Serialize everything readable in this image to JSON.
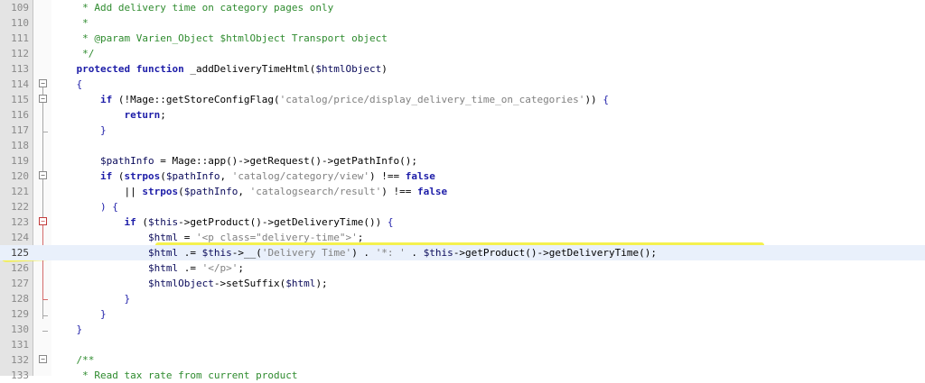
{
  "editor": {
    "lines": [
      {
        "n": "109",
        "s": [
          {
            "t": "     "
          },
          {
            "c": "t-cm",
            "t": "* Add delivery time on category pages only"
          }
        ]
      },
      {
        "n": "110",
        "s": [
          {
            "t": "     "
          },
          {
            "c": "t-cm",
            "t": "*"
          }
        ]
      },
      {
        "n": "111",
        "s": [
          {
            "t": "     "
          },
          {
            "c": "t-cm",
            "t": "* @param Varien_Object $htmlObject Transport object"
          }
        ]
      },
      {
        "n": "112",
        "s": [
          {
            "t": "     "
          },
          {
            "c": "t-cm",
            "t": "*/"
          }
        ]
      },
      {
        "n": "113",
        "s": [
          {
            "t": "    "
          },
          {
            "c": "t-kw",
            "t": "protected function"
          },
          {
            "c": "t-fn",
            "t": " _addDeliveryTimeHtml("
          },
          {
            "c": "t-var",
            "t": "$htmlObject"
          },
          {
            "c": "t-fn",
            "t": ")"
          }
        ]
      },
      {
        "n": "114",
        "s": [
          {
            "t": "    "
          },
          {
            "c": "t-br",
            "t": "{"
          }
        ]
      },
      {
        "n": "115",
        "s": [
          {
            "t": "        "
          },
          {
            "c": "t-kw",
            "t": "if"
          },
          {
            "c": "t-op",
            "t": " (!Mage::getStoreConfigFlag("
          },
          {
            "c": "t-str",
            "t": "'catalog/price/display_delivery_time_on_categories'"
          },
          {
            "c": "t-op",
            "t": ")) "
          },
          {
            "c": "t-br",
            "t": "{"
          }
        ]
      },
      {
        "n": "116",
        "s": [
          {
            "t": "            "
          },
          {
            "c": "t-kw",
            "t": "return"
          },
          {
            "c": "t-op",
            "t": ";"
          }
        ]
      },
      {
        "n": "117",
        "s": [
          {
            "t": "        "
          },
          {
            "c": "t-br",
            "t": "}"
          }
        ]
      },
      {
        "n": "118",
        "s": []
      },
      {
        "n": "119",
        "s": [
          {
            "t": "        "
          },
          {
            "c": "t-var",
            "t": "$pathInfo"
          },
          {
            "c": "t-op",
            "t": " = Mage::app()->getRequest()->getPathInfo();"
          }
        ]
      },
      {
        "n": "120",
        "s": [
          {
            "t": "        "
          },
          {
            "c": "t-kw",
            "t": "if"
          },
          {
            "c": "t-op",
            "t": " ("
          },
          {
            "c": "t-kw",
            "t": "strpos"
          },
          {
            "c": "t-op",
            "t": "("
          },
          {
            "c": "t-var",
            "t": "$pathInfo"
          },
          {
            "c": "t-op",
            "t": ", "
          },
          {
            "c": "t-str",
            "t": "'catalog/category/view'"
          },
          {
            "c": "t-op",
            "t": ") !== "
          },
          {
            "c": "t-kw",
            "t": "false"
          }
        ]
      },
      {
        "n": "121",
        "s": [
          {
            "t": "            "
          },
          {
            "c": "t-op",
            "t": "|| "
          },
          {
            "c": "t-kw",
            "t": "strpos"
          },
          {
            "c": "t-op",
            "t": "("
          },
          {
            "c": "t-var",
            "t": "$pathInfo"
          },
          {
            "c": "t-op",
            "t": ", "
          },
          {
            "c": "t-str",
            "t": "'catalogsearch/result'"
          },
          {
            "c": "t-op",
            "t": ") !== "
          },
          {
            "c": "t-kw",
            "t": "false"
          }
        ]
      },
      {
        "n": "122",
        "s": [
          {
            "t": "        "
          },
          {
            "c": "t-br",
            "t": ") {"
          }
        ]
      },
      {
        "n": "123",
        "s": [
          {
            "t": "            "
          },
          {
            "c": "t-kw",
            "t": "if"
          },
          {
            "c": "t-op",
            "t": " ("
          },
          {
            "c": "t-var",
            "t": "$this"
          },
          {
            "c": "t-op",
            "t": "->getProduct()->getDeliveryTime()) "
          },
          {
            "c": "t-br",
            "t": "{"
          }
        ]
      },
      {
        "n": "124",
        "s": [
          {
            "t": "                "
          },
          {
            "c": "t-var",
            "t": "$html"
          },
          {
            "c": "t-op",
            "t": " = "
          },
          {
            "c": "t-str",
            "t": "'<p class=\"delivery-time\">'"
          },
          {
            "c": "t-op",
            "t": ";"
          }
        ]
      },
      {
        "n": "125",
        "active": true,
        "s": [
          {
            "t": "                "
          },
          {
            "c": "t-var",
            "t": "$html"
          },
          {
            "c": "t-op",
            "t": " .= "
          },
          {
            "c": "t-var",
            "t": "$this"
          },
          {
            "c": "t-op",
            "t": "->__("
          },
          {
            "c": "t-str",
            "t": "'Delivery Time'"
          },
          {
            "c": "t-op",
            "t": ") . "
          },
          {
            "c": "t-str",
            "t": "'*: '"
          },
          {
            "c": "t-op",
            "t": " . "
          },
          {
            "c": "t-var",
            "t": "$this"
          },
          {
            "c": "t-op",
            "t": "->getProduct()->getDeliveryTime();"
          }
        ]
      },
      {
        "n": "126",
        "s": [
          {
            "t": "                "
          },
          {
            "c": "t-var",
            "t": "$html"
          },
          {
            "c": "t-op",
            "t": " .= "
          },
          {
            "c": "t-str",
            "t": "'</p>'"
          },
          {
            "c": "t-op",
            "t": ";"
          }
        ]
      },
      {
        "n": "127",
        "s": [
          {
            "t": "                "
          },
          {
            "c": "t-var",
            "t": "$htmlObject"
          },
          {
            "c": "t-op",
            "t": "->setSuffix("
          },
          {
            "c": "t-var",
            "t": "$html"
          },
          {
            "c": "t-op",
            "t": ");"
          }
        ]
      },
      {
        "n": "128",
        "s": [
          {
            "t": "            "
          },
          {
            "c": "t-br",
            "t": "}"
          }
        ]
      },
      {
        "n": "129",
        "s": [
          {
            "t": "        "
          },
          {
            "c": "t-br",
            "t": "}"
          }
        ]
      },
      {
        "n": "130",
        "s": [
          {
            "t": "    "
          },
          {
            "c": "t-br",
            "t": "}"
          }
        ]
      },
      {
        "n": "131",
        "s": []
      },
      {
        "n": "132",
        "s": [
          {
            "t": "    "
          },
          {
            "c": "t-cm",
            "t": "/**"
          }
        ]
      },
      {
        "n": "133",
        "s": [
          {
            "t": "     "
          },
          {
            "c": "t-cm",
            "t": "* Read tax rate from current product"
          }
        ]
      }
    ]
  },
  "colors": {
    "highlight": "#f3f04a",
    "keyword": "#1d1da8",
    "comment": "#2e8b2e",
    "string": "#808080"
  }
}
